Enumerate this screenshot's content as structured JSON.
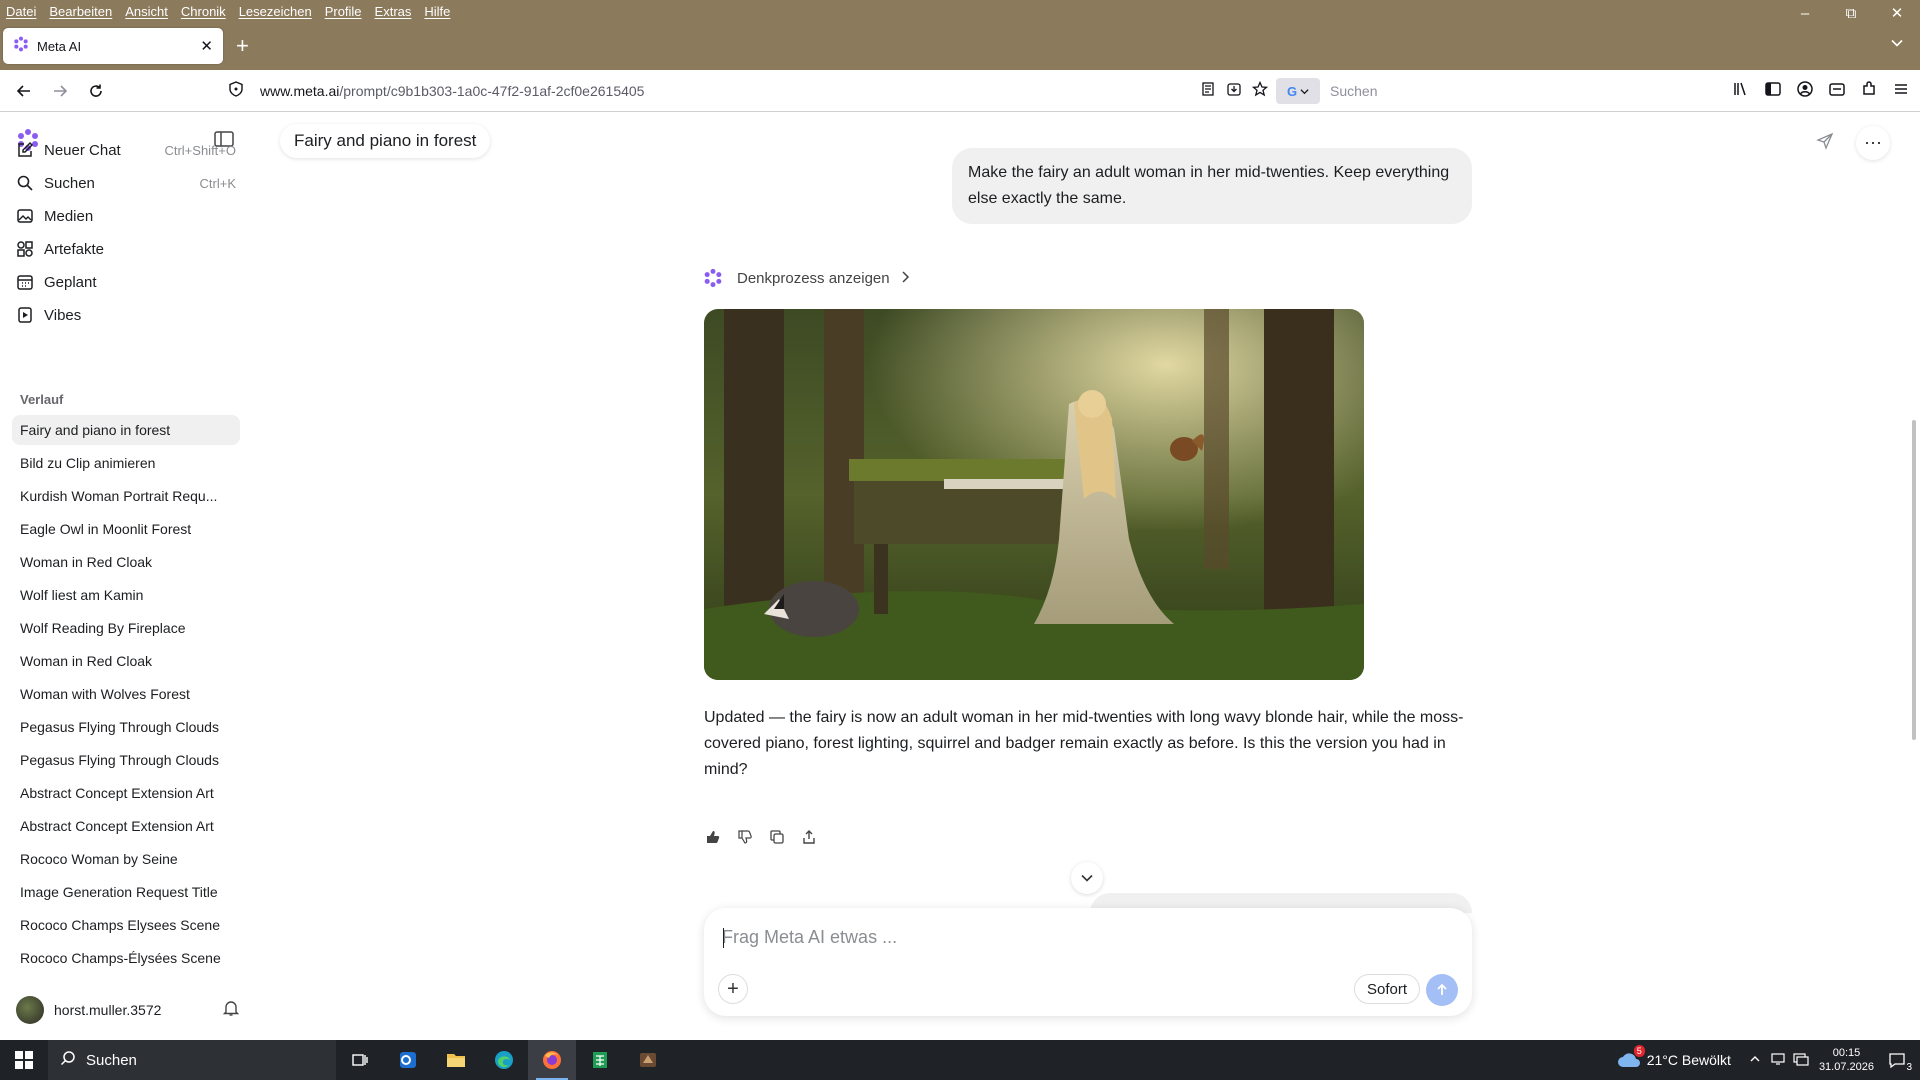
{
  "browser": {
    "menu": [
      "Datei",
      "Bearbeiten",
      "Ansicht",
      "Chronik",
      "Lesezeichen",
      "Profile",
      "Extras",
      "Hilfe"
    ],
    "tab_title": "Meta AI",
    "url_domain": "www.meta.ai",
    "url_path": "/prompt/c9b1b303-1a0c-47f2-91af-2cf0e2615405",
    "search_placeholder": "Suchen"
  },
  "sidebar": {
    "nav": [
      {
        "label": "Neuer Chat",
        "shortcut": "Ctrl+Shift+O",
        "icon": "edit-icon"
      },
      {
        "label": "Suchen",
        "shortcut": "Ctrl+K",
        "icon": "search-icon"
      },
      {
        "label": "Medien",
        "shortcut": "",
        "icon": "image-icon"
      },
      {
        "label": "Artefakte",
        "shortcut": "",
        "icon": "grid-icon"
      },
      {
        "label": "Geplant",
        "shortcut": "",
        "icon": "calendar-icon"
      },
      {
        "label": "Vibes",
        "shortcut": "",
        "icon": "play-icon"
      }
    ],
    "history_label": "Verlauf",
    "history": [
      "Fairy and piano in forest",
      "Bild zu Clip animieren",
      "Kurdish Woman Portrait Requ...",
      "Eagle Owl in Moonlit Forest",
      "Woman in Red Cloak",
      "Wolf liest am Kamin",
      "Wolf Reading By Fireplace",
      "Woman in Red Cloak",
      "Woman with Wolves Forest",
      "Pegasus Flying Through Clouds",
      "Pegasus Flying Through Clouds",
      "Abstract Concept Extension Art",
      "Abstract Concept Extension Art",
      "Rococo Woman by Seine",
      "Image Generation Request Title",
      "Rococo Champs Elysees Scene",
      "Rococo Champs-Élysées Scene"
    ],
    "username": "horst.muller.3572"
  },
  "chat": {
    "title": "Fairy and piano in forest",
    "user_message": "Make the fairy an adult woman in her mid-twenties. Keep everything else exactly the same.",
    "thinking_label": "Denkprozess anzeigen",
    "ai_response": "Updated — the fairy is now an adult woman in her mid-twenties with long wavy blonde hair, while the moss-covered piano, forest lighting, squirrel and badger remain exactly as before. Is this the version you had in mind?",
    "composer_placeholder": "Frag Meta AI etwas ...",
    "mode_label": "Sofort"
  },
  "taskbar": {
    "search_label": "Suchen",
    "weather": "21°C  Bewölkt",
    "weather_badge": "5",
    "time": "00:15",
    "date": "31.07.2026",
    "notifications": "3"
  },
  "colors": {
    "chrome": "#8c7a5c",
    "accent_send": "#a4bff5",
    "meta_gradient": [
      "#4f7cff",
      "#b24be0"
    ]
  }
}
